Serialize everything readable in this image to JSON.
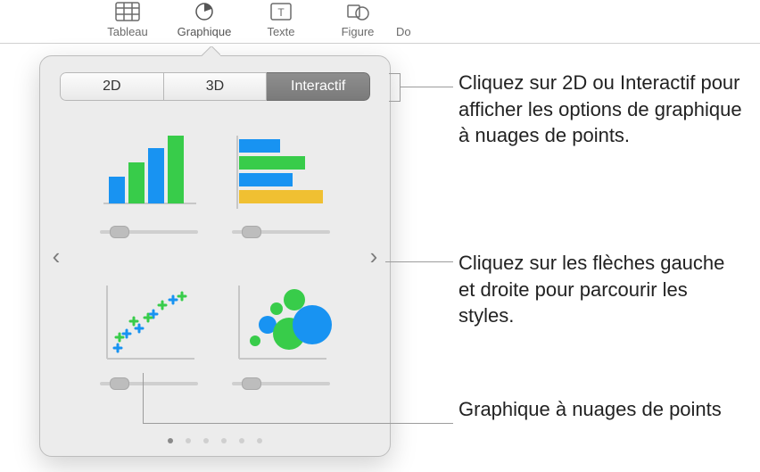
{
  "toolbar": {
    "items": [
      {
        "label": "Tableau",
        "icon": "table-icon"
      },
      {
        "label": "Graphique",
        "icon": "pie-icon"
      },
      {
        "label": "Texte",
        "icon": "text-icon"
      },
      {
        "label": "Figure",
        "icon": "shape-icon"
      },
      {
        "label": "Do",
        "icon": "doc-icon"
      }
    ],
    "active_index": 1
  },
  "popover": {
    "tabs": {
      "t2d": "2D",
      "t3d": "3D",
      "interactive": "Interactif"
    },
    "selected_tab": "interactive",
    "nav": {
      "prev": "‹",
      "next": "›"
    },
    "page_count": 6,
    "current_page": 0,
    "charts": [
      {
        "kind": "column-chart",
        "slider_pos": 0.2
      },
      {
        "kind": "bar-chart",
        "slider_pos": 0.2
      },
      {
        "kind": "scatter-chart",
        "slider_pos": 0.2
      },
      {
        "kind": "bubble-chart",
        "slider_pos": 0.2
      }
    ]
  },
  "callouts": {
    "tabs_text": "Cliquez sur 2D ou Interactif pour afficher les options de graphique à nuages de points.",
    "arrows_text": "Cliquez sur les flèches gauche et droite pour parcourir les styles.",
    "scatter_text": "Graphique à nuages de points"
  },
  "colors": {
    "blue": "#1893f2",
    "green": "#38cc4a",
    "yellow": "#f0c032",
    "axis": "#c7c7c7"
  }
}
